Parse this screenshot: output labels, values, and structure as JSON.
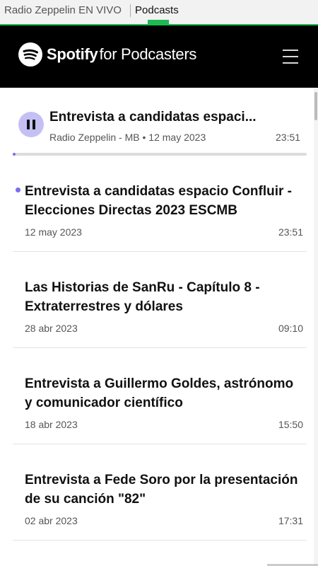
{
  "tabs": {
    "tab1": "Radio Zeppelin EN VIVO",
    "tab2": "Podcasts"
  },
  "header": {
    "brand": "Spotify",
    "brand_suffix": "for Podcasters"
  },
  "now_playing": {
    "title": "Entrevista a candidatas espaci...",
    "meta": "Radio Zeppelin - MB • 12 may 2023",
    "duration": "23:51",
    "progress": 0.01
  },
  "episodes": [
    {
      "title": "Entrevista a candidatas espacio Confluir - Elecciones Directas 2023 ESCMB",
      "date": "12 may 2023",
      "duration": "23:51",
      "new": true
    },
    {
      "title": "Las Historias de SanRu - Capítulo 8 - Extraterrestres y dólares",
      "date": "28 abr 2023",
      "duration": "09:10",
      "new": false
    },
    {
      "title": "Entrevista a Guillermo Goldes, astrónomo y comunicador científico",
      "date": "18 abr 2023",
      "duration": "15:50",
      "new": false
    },
    {
      "title": "Entrevista a Fede Soro por la presentación de su canción \"82\"",
      "date": "02 abr 2023",
      "duration": "17:31",
      "new": false
    }
  ],
  "colors": {
    "accent": "#7a6df0",
    "play_bg": "#c5c0f4",
    "tab_indicator": "#1db954"
  }
}
